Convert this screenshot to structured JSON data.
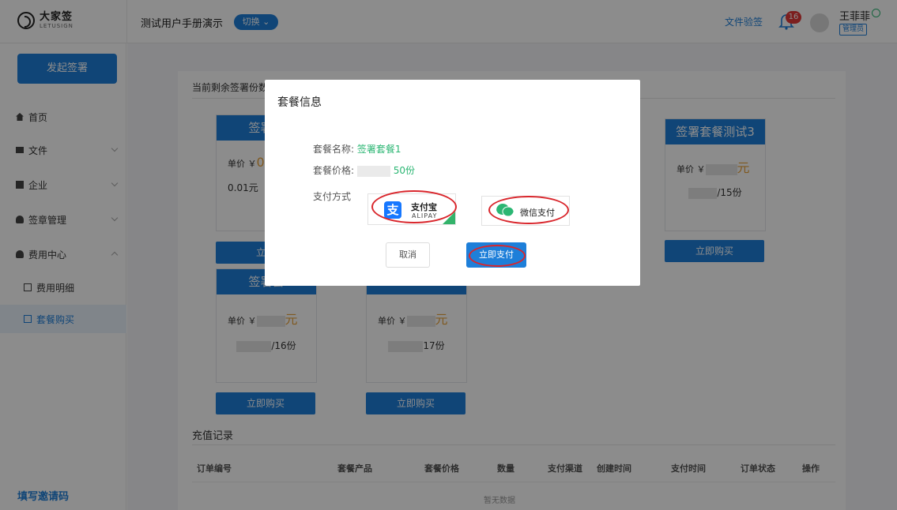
{
  "header": {
    "logo_cn": "大家签",
    "logo_en": "LETUSIGN",
    "company": "测试用户手册演示",
    "switch_label": "切换",
    "verify_link": "文件验签",
    "notification_count": "16",
    "username": "王菲菲",
    "role": "管理员"
  },
  "sidebar": {
    "start_button": "发起签署",
    "items": [
      {
        "label": "首页"
      },
      {
        "label": "文件"
      },
      {
        "label": "企业"
      },
      {
        "label": "签章管理"
      },
      {
        "label": "费用中心"
      },
      {
        "label": "费用明细"
      },
      {
        "label": "套餐购买"
      }
    ],
    "invite_link": "填写邀请码"
  },
  "main": {
    "remaining_label": "当前剩余签署份数",
    "packages": [
      {
        "title": "签署套",
        "price_label": "单价 ￥",
        "price": "0",
        "count": "0.01元",
        "buy": "立即"
      },
      {
        "title": "签署套餐测试3",
        "price_label": "单价 ￥",
        "price_unit": "元",
        "count": "/15份",
        "buy": "立即购买"
      },
      {
        "title": "签署套",
        "price_label": "单价 ￥",
        "price_unit": "元",
        "count": "/16份",
        "buy": "立即购买"
      },
      {
        "title": "",
        "price_label": "单价 ￥",
        "price_unit": "元",
        "count": "17份",
        "buy": "立即购买"
      }
    ],
    "records_title": "充值记录",
    "records_columns": [
      "订单编号",
      "套餐产品",
      "套餐价格",
      "数量",
      "支付渠道",
      "创建时间",
      "支付时间",
      "订单状态",
      "操作"
    ],
    "no_data": "暂无数据"
  },
  "modal": {
    "title": "套餐信息",
    "name_label": "套餐名称:",
    "name_value": "签署套餐1",
    "price_label": "套餐价格:",
    "price_value": "50份",
    "pay_label": "支付方式",
    "alipay_cn": "支付宝",
    "alipay_en": "ALIPAY",
    "wechat": "微信支付",
    "cancel": "取消",
    "pay_now": "立即支付"
  },
  "colors": {
    "primary": "#1e7fd9",
    "accent_green": "#2bb673",
    "highlight_ring": "#d9262c"
  }
}
